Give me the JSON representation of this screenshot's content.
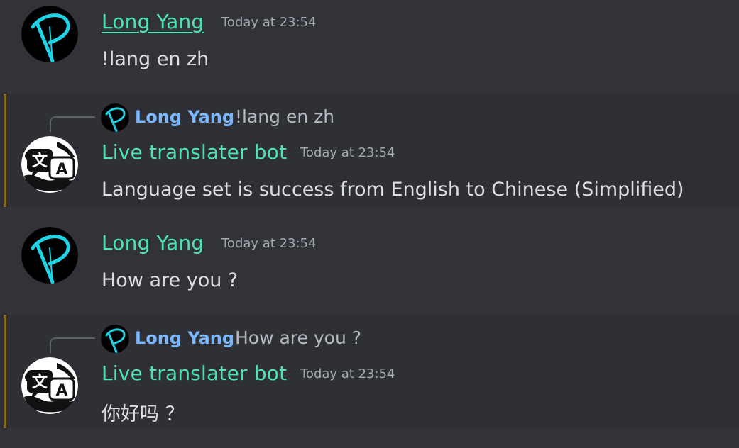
{
  "messages": [
    {
      "author": "Long Yang",
      "timestamp": "Today at 23:54",
      "text": "!lang en zh",
      "avatar": "tie-logo-avatar"
    },
    {
      "reply_to": {
        "author": "Long Yang",
        "text": "!lang en zh"
      },
      "author": "Live translater bot",
      "timestamp": "Today at 23:54",
      "text": "Language set is success from English to Chinese (Simplified)",
      "avatar": "translate-icon-avatar"
    },
    {
      "author": "Long Yang",
      "timestamp": "Today at 23:54",
      "text": "How are you ?",
      "avatar": "tie-logo-avatar"
    },
    {
      "reply_to": {
        "author": "Long Yang",
        "text": "How are you ?"
      },
      "author": "Live translater bot",
      "timestamp": "Today at 23:54",
      "text": "你好吗 ？",
      "avatar": "translate-icon-avatar"
    }
  ],
  "colors": {
    "background": "#313338",
    "username": "#4de3b6",
    "reply_username": "#7ab8ff",
    "highlight_bar": "#8a6a1f",
    "avatar_ring": "#1fd3e6"
  },
  "avatar_glyphs": {
    "translate_left": "文",
    "translate_right": "A"
  }
}
